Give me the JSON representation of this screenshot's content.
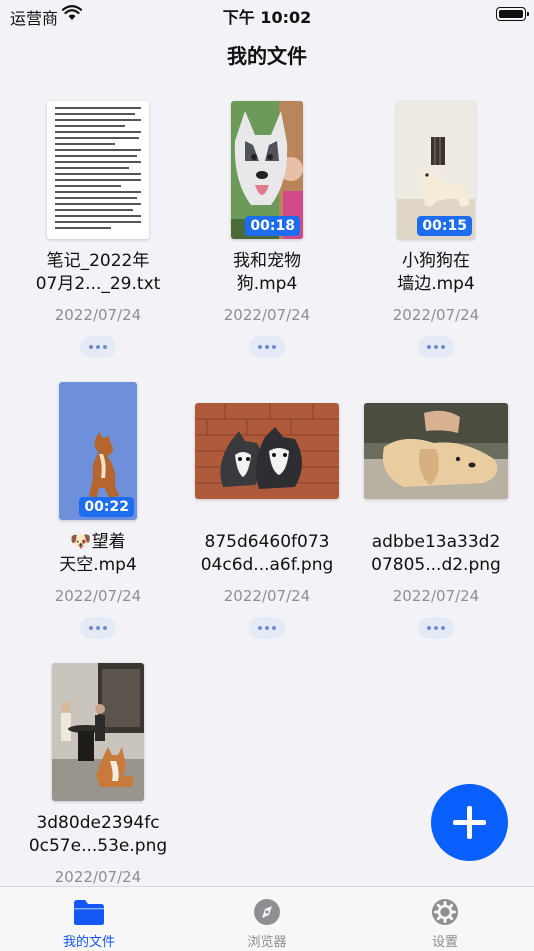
{
  "status_bar": {
    "carrier": "运营商",
    "time": "下午 10:02"
  },
  "page": {
    "title": "我的文件"
  },
  "files": [
    {
      "name": "笔记_2022年\n07月2..._29.txt",
      "date": "2022/07/24",
      "type": "document",
      "duration": ""
    },
    {
      "name": "我和宠物\n狗.mp4",
      "date": "2022/07/24",
      "type": "video",
      "duration": "00:18"
    },
    {
      "name": "小狗狗在\n墙边.mp4",
      "date": "2022/07/24",
      "type": "video",
      "duration": "00:15"
    },
    {
      "name": "🐶望着\n天空.mp4",
      "date": "2022/07/24",
      "type": "video",
      "duration": "00:22"
    },
    {
      "name": "875d6460f073\n04c6d...a6f.png",
      "date": "2022/07/24",
      "type": "image",
      "duration": ""
    },
    {
      "name": "adbbe13a33d2\n07805...d2.png",
      "date": "2022/07/24",
      "type": "image",
      "duration": ""
    },
    {
      "name": "3d80de2394fc\n0c57e...53e.png",
      "date": "2022/07/24",
      "type": "image",
      "duration": ""
    }
  ],
  "tab_bar": {
    "tabs": [
      {
        "label": "我的文件",
        "icon": "folder-icon",
        "active": true
      },
      {
        "label": "浏览器",
        "icon": "compass-icon",
        "active": false
      },
      {
        "label": "设置",
        "icon": "gear-icon",
        "active": false
      }
    ]
  },
  "colors": {
    "accent": "#1457f5",
    "fab": "#0a5fff",
    "badge": "#1e6cf0"
  }
}
